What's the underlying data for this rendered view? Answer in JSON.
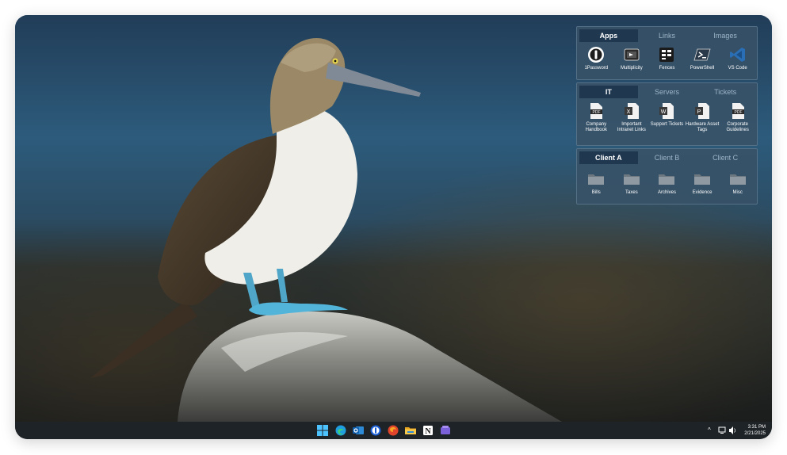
{
  "desktop": {
    "wallpaper_subject": "blue-footed booby on rock"
  },
  "fences": [
    {
      "tabs": [
        "Apps",
        "Links",
        "Images"
      ],
      "active_tab": 0,
      "items": [
        {
          "label": "1Password",
          "icon": "onepassword-icon"
        },
        {
          "label": "Multiplicity",
          "icon": "multiplicity-icon"
        },
        {
          "label": "Fences",
          "icon": "fences-icon"
        },
        {
          "label": "PowerShell",
          "icon": "powershell-icon"
        },
        {
          "label": "VS Code",
          "icon": "vscode-icon"
        }
      ]
    },
    {
      "tabs": [
        "IT",
        "Servers",
        "Tickets"
      ],
      "active_tab": 0,
      "items": [
        {
          "label": "Company Handbook",
          "icon": "pdf-icon"
        },
        {
          "label": "Important Intranet Links",
          "icon": "excel-icon"
        },
        {
          "label": "Support Tickets",
          "icon": "word-icon"
        },
        {
          "label": "Hardware Asset Tags",
          "icon": "powerpoint-icon"
        },
        {
          "label": "Corporate Guidelines",
          "icon": "pdf-icon"
        }
      ]
    },
    {
      "tabs": [
        "Client A",
        "Client B",
        "Client C"
      ],
      "active_tab": 0,
      "items": [
        {
          "label": "Bills",
          "icon": "folder-icon"
        },
        {
          "label": "Taxes",
          "icon": "folder-icon"
        },
        {
          "label": "Archives",
          "icon": "folder-icon"
        },
        {
          "label": "Evidence",
          "icon": "folder-icon"
        },
        {
          "label": "Misc",
          "icon": "folder-icon"
        }
      ]
    }
  ],
  "taskbar": {
    "apps": [
      "windows-start-icon",
      "edge-icon",
      "outlook-icon",
      "onepassword-icon",
      "browser-red-icon",
      "file-explorer-icon",
      "notion-icon",
      "teams-icon"
    ],
    "clock_time": "3:31 PM",
    "clock_date": "2/21/2025"
  },
  "colors": {
    "fence_bg": "#385268",
    "fence_tab_active": "#1f3850",
    "taskbar": "#1e2327"
  }
}
